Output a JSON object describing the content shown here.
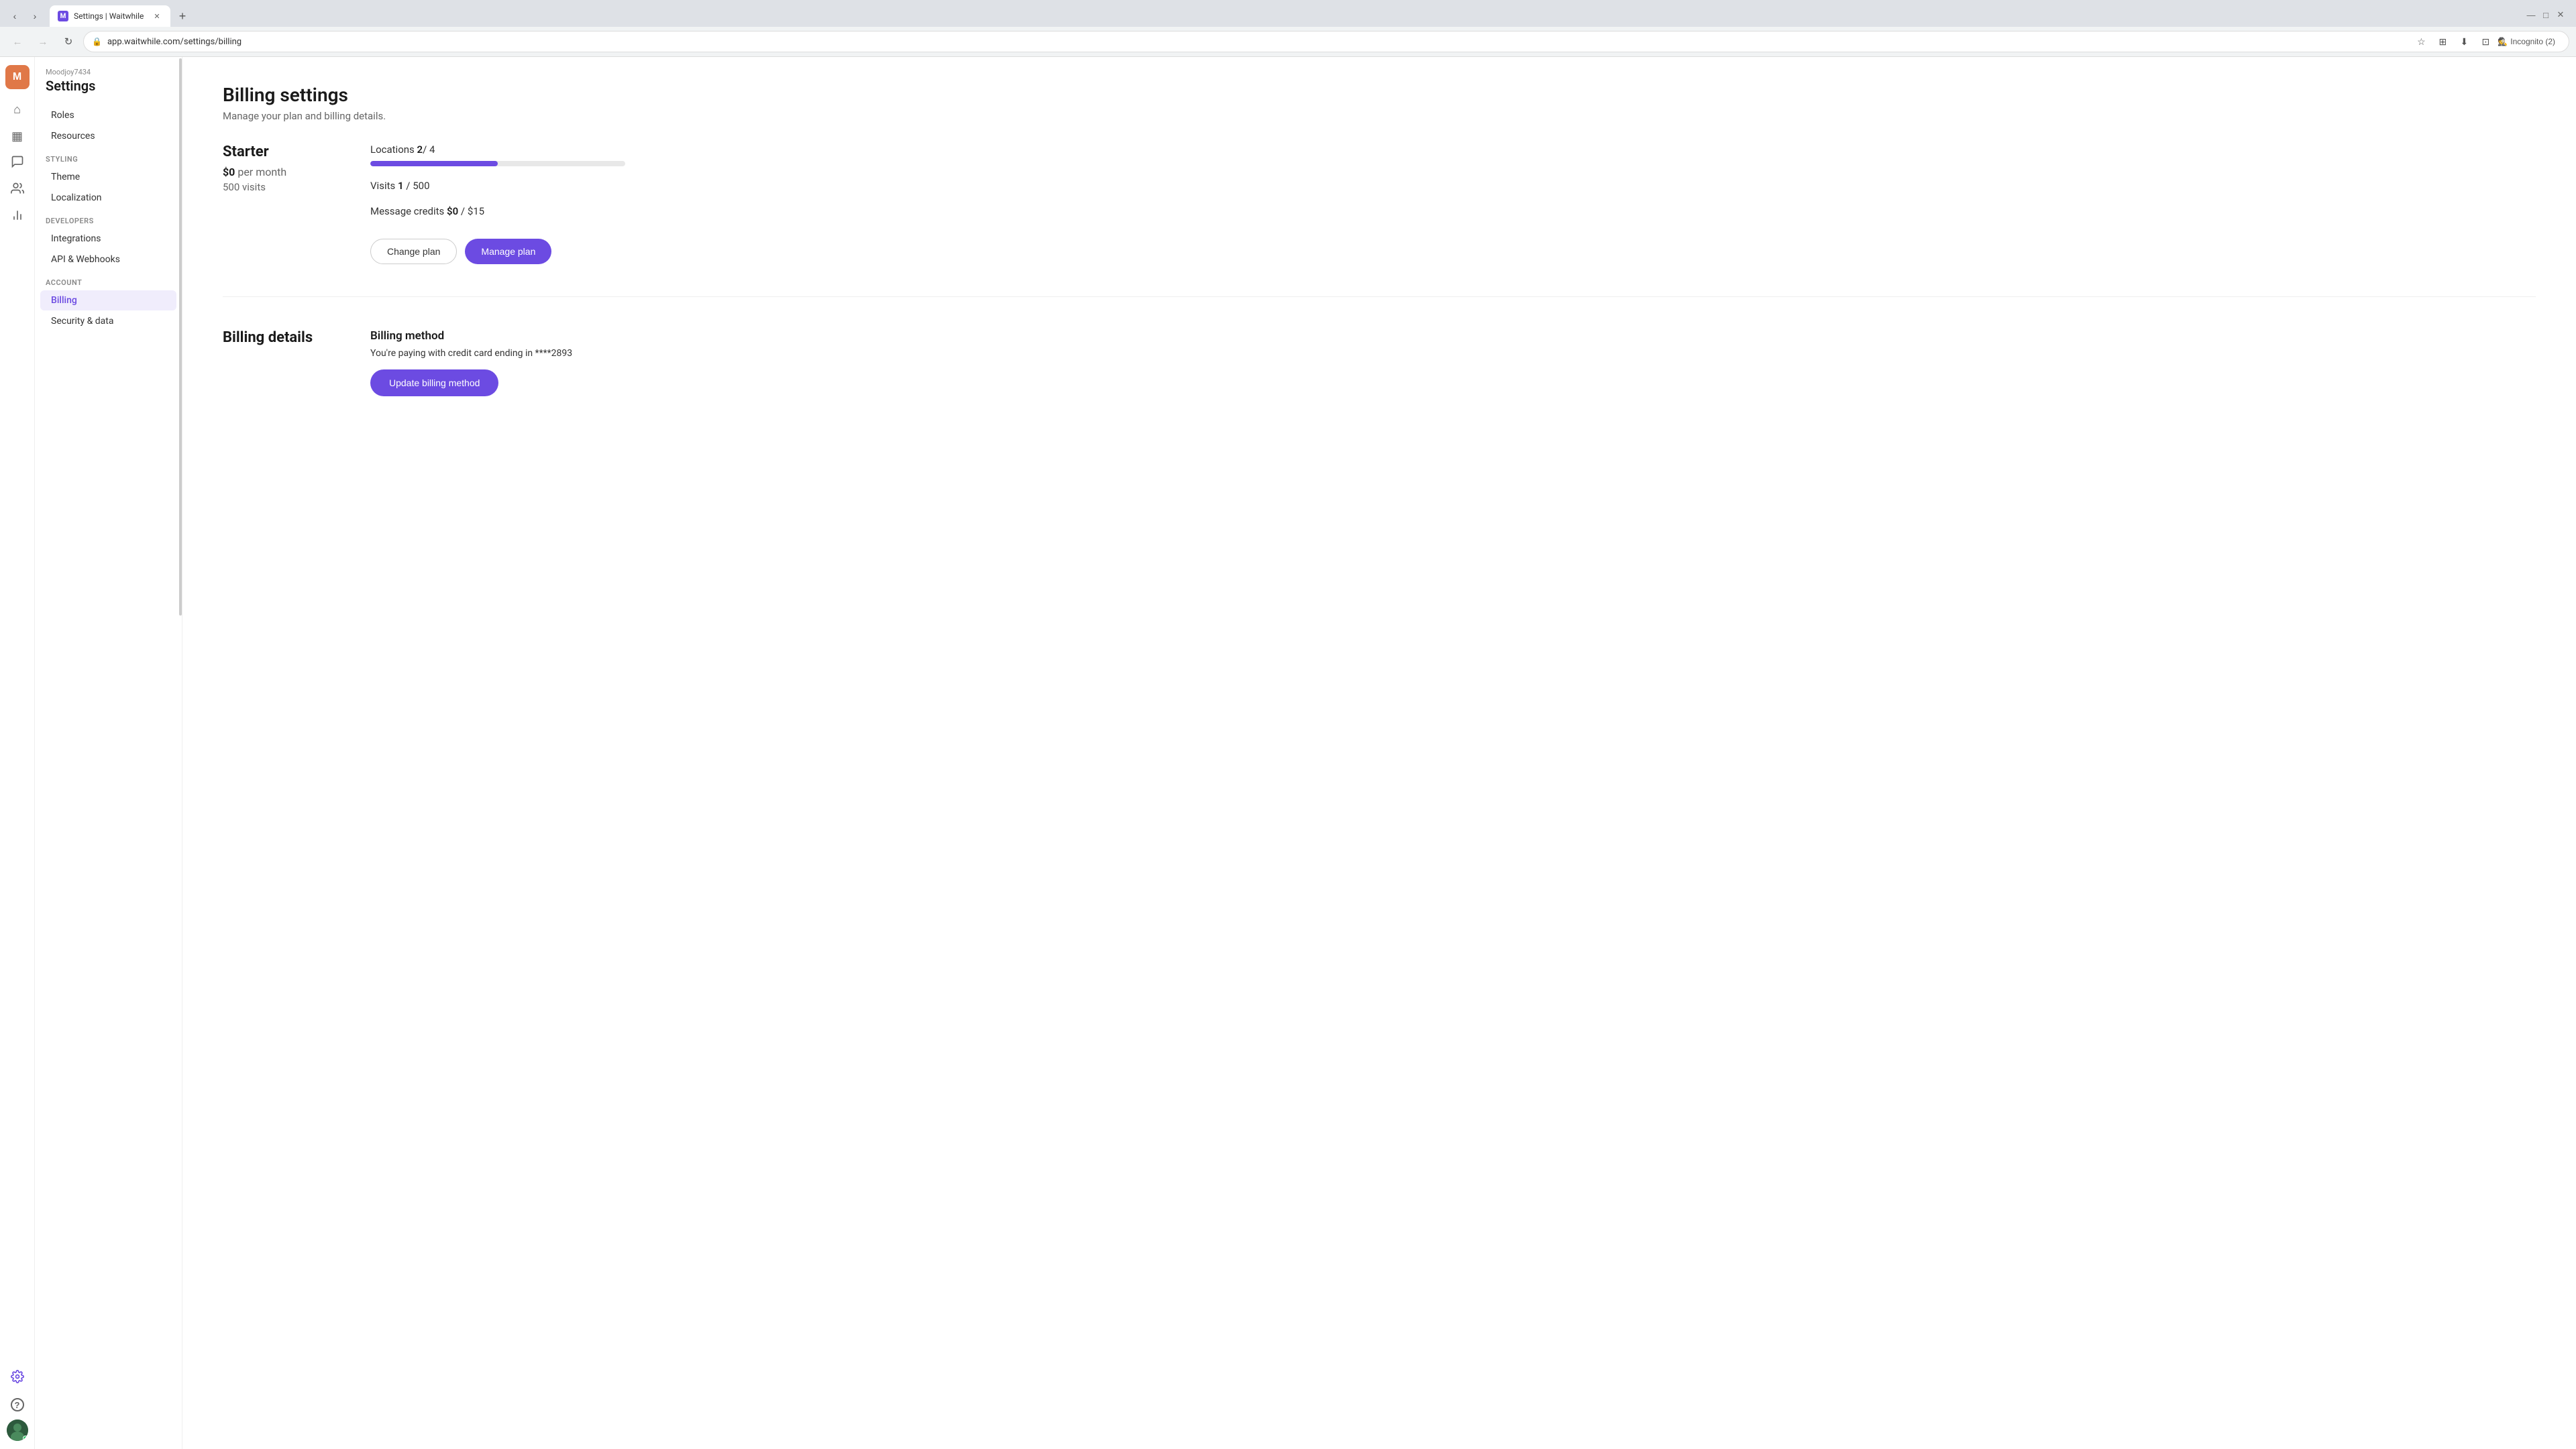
{
  "browser": {
    "tab_title": "Settings | Waitwhile",
    "tab_favicon": "M",
    "url": "app.waitwhile.com/settings/billing",
    "incognito_label": "Incognito (2)"
  },
  "sidebar": {
    "account_name": "Moodjoy7434",
    "title": "Settings",
    "sections": [
      {
        "items": [
          {
            "label": "Roles",
            "active": false
          },
          {
            "label": "Resources",
            "active": false
          }
        ]
      },
      {
        "header": "Styling",
        "items": [
          {
            "label": "Theme",
            "active": false
          },
          {
            "label": "Localization",
            "active": false
          }
        ]
      },
      {
        "header": "Developers",
        "items": [
          {
            "label": "Integrations",
            "active": false
          },
          {
            "label": "API & Webhooks",
            "active": false
          }
        ]
      },
      {
        "header": "Account",
        "items": [
          {
            "label": "Billing",
            "active": true
          },
          {
            "label": "Security & data",
            "active": false
          }
        ]
      }
    ]
  },
  "main": {
    "page_title": "Billing settings",
    "page_subtitle": "Manage your plan and billing details.",
    "plan": {
      "name": "Starter",
      "price": "$0",
      "period": "per month",
      "visits_included": "500 visits",
      "locations_label": "Locations",
      "locations_current": "2",
      "locations_total": "4",
      "locations_progress": 50,
      "visits_label": "Visits",
      "visits_current": "1",
      "visits_total": "500",
      "visits_progress": 0.2,
      "message_credits_label": "Message credits",
      "message_credits_current": "$0",
      "message_credits_total": "$15",
      "btn_change": "Change plan",
      "btn_manage": "Manage plan"
    },
    "billing_details": {
      "section_label": "Billing details",
      "method_title": "Billing method",
      "method_desc": "You're paying with credit card ending in ****2893",
      "btn_update": "Update billing method"
    }
  },
  "icons": {
    "home": "⌂",
    "calendar": "▦",
    "chat": "💬",
    "team": "👥",
    "analytics": "📊",
    "settings": "⚙",
    "help": "?",
    "back_arrow": "←",
    "forward_arrow": "→",
    "refresh": "↻",
    "star": "☆",
    "download": "⬇",
    "profile": "⊡",
    "lock": "🔒"
  }
}
